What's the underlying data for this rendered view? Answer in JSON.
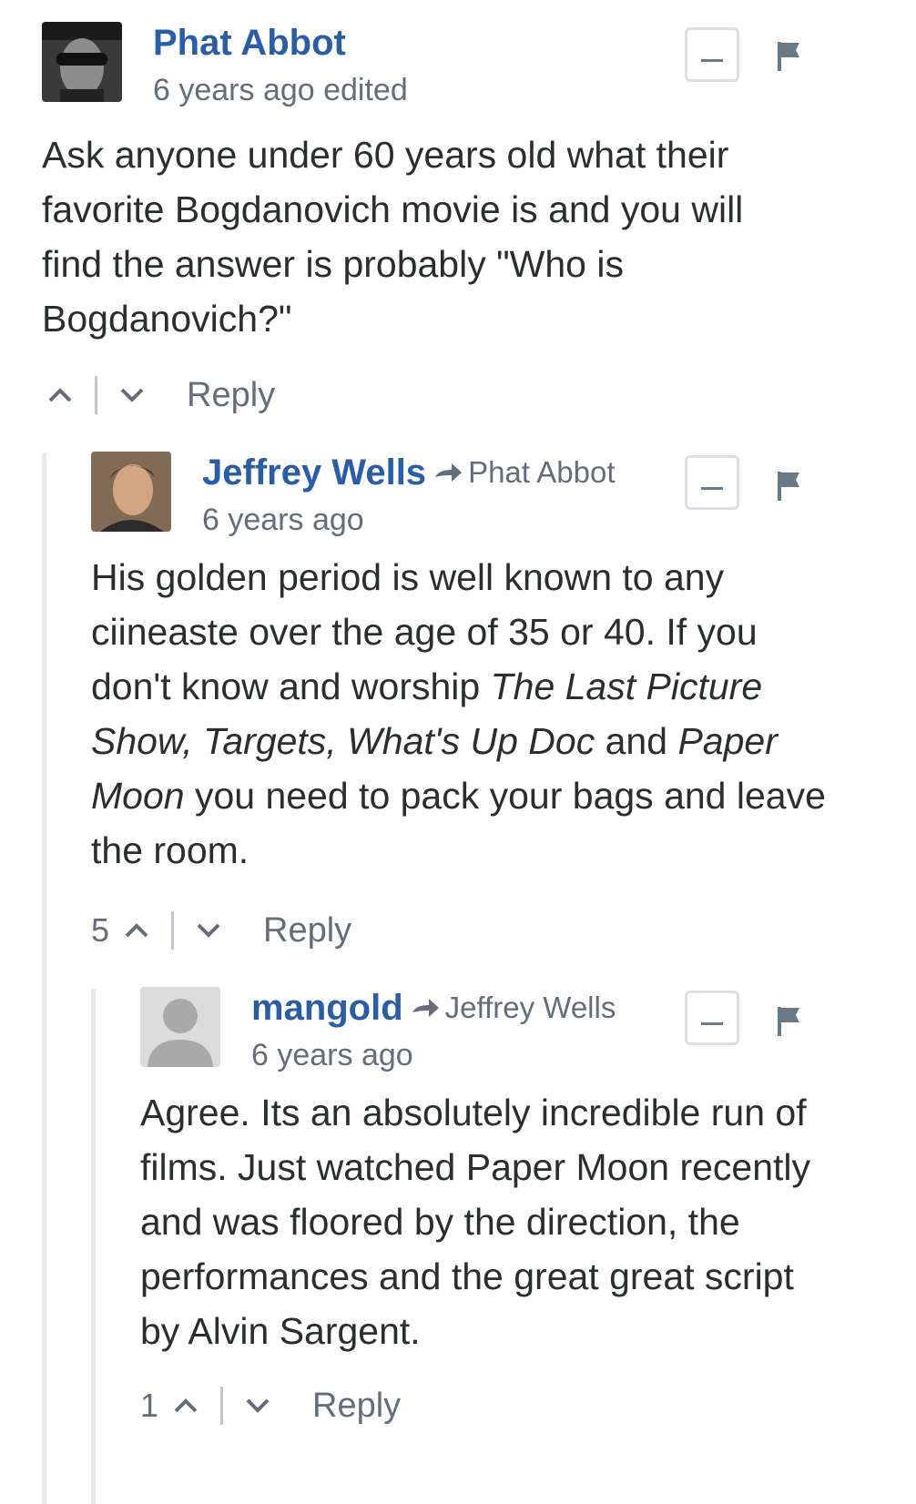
{
  "comments": [
    {
      "author": "Phat Abbot",
      "reply_to": "",
      "meta": "6 years ago edited",
      "body": "Ask anyone under 60 years old what their favorite Bogdanovich movie is and you will find the answer is probably \"Who is Bogdanovich?\"",
      "votes": "",
      "reply_label": "Reply"
    },
    {
      "author": "Jeffrey Wells",
      "reply_to": "Phat Abbot",
      "meta": "6 years ago",
      "body_parts": [
        {
          "text": "His golden period is well known to any ciineaste over the age of 35 or 40. If you don't know and worship ",
          "italic": false
        },
        {
          "text": "The Last Picture Show, Targets, What's Up Doc",
          "italic": true
        },
        {
          "text": " and ",
          "italic": false
        },
        {
          "text": "Paper Moon",
          "italic": true
        },
        {
          "text": " you need to pack your bags and leave the room.",
          "italic": false
        }
      ],
      "votes": "5",
      "reply_label": "Reply"
    },
    {
      "author": "mangold",
      "reply_to": "Jeffrey Wells",
      "meta": "6 years ago",
      "body": "Agree. Its an absolutely incredible run of films. Just watched Paper Moon recently and was floored by the direction, the performances and the great great script by Alvin Sargent.",
      "votes": "1",
      "reply_label": "Reply"
    }
  ],
  "colors": {
    "author": "#2a5da8",
    "meta": "#656c7a",
    "text": "#2a2e2e",
    "thread_line": "#e7e9ee"
  }
}
